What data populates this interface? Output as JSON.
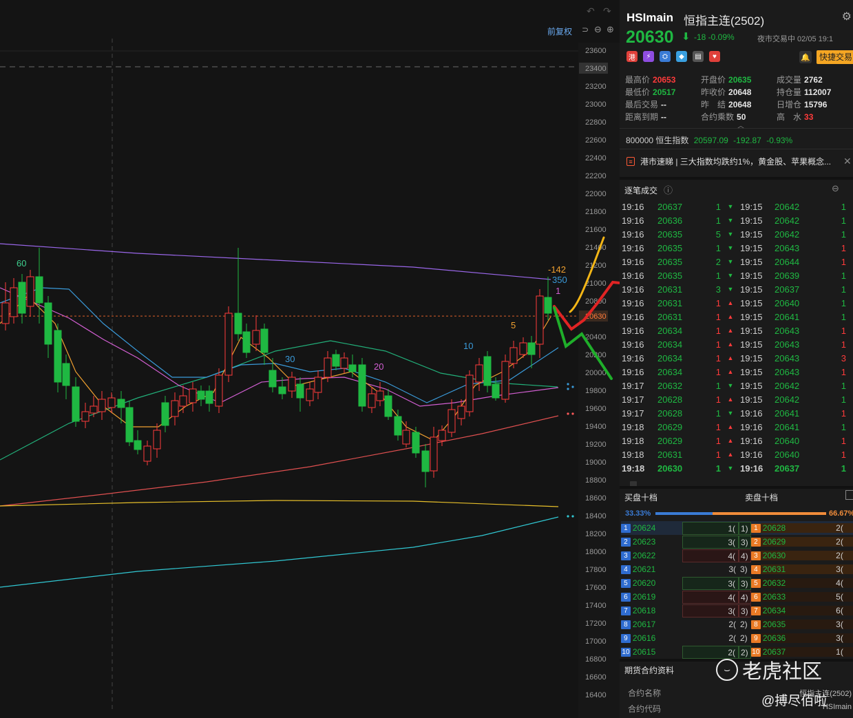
{
  "chart": {
    "fq_label": "前复权",
    "price_ticks": [
      "23600",
      "23400",
      "23200",
      "23000",
      "22800",
      "22600",
      "22400",
      "22200",
      "22000",
      "21800",
      "21600",
      "21400",
      "21200",
      "21000",
      "20800",
      "20630",
      "20400",
      "20200",
      "20000",
      "19800",
      "19600",
      "19400",
      "19200",
      "19000",
      "18800",
      "18600",
      "18400",
      "18200",
      "18000",
      "17800",
      "17600",
      "17400",
      "17200",
      "17000",
      "16800",
      "16600",
      "16400"
    ],
    "ma_labels": {
      "m60": "60",
      "m30": "30",
      "m20": "20",
      "m10": "10",
      "m5": "5",
      "m1": "1",
      "m350": "350",
      "m142": "-142"
    },
    "colors": {
      "up": "#ff3b3b",
      "down": "#1fb842",
      "ma5": "#f0a030",
      "ma10": "#3a9ad9",
      "ma20": "#d25fd2",
      "ma60": "#22b07a",
      "ma120": "#9a67ea",
      "ma250": "#e05050",
      "maY": "#e8c02a",
      "maC": "#31c9d4"
    }
  },
  "header": {
    "symbol": "HSImain",
    "name": "恒指主连(2502)",
    "price": "20630",
    "arrow": "⬇",
    "change": "-18 -0.09%",
    "status": "夜市交易中 02/05 19:1"
  },
  "badges": [
    "港",
    "⚡",
    "⛭",
    "◆",
    "▤",
    "♥"
  ],
  "quick_trade": "快捷交易",
  "stats": [
    [
      {
        "l": "最高价",
        "v": "20653",
        "c": "red"
      },
      {
        "l": "开盘价",
        "v": "20635",
        "c": "green"
      },
      {
        "l": "成交量",
        "v": "2762",
        "c": ""
      }
    ],
    [
      {
        "l": "最低价",
        "v": "20517",
        "c": "green"
      },
      {
        "l": "昨收价",
        "v": "20648",
        "c": ""
      },
      {
        "l": "持仓量",
        "v": "112007",
        "c": ""
      }
    ],
    [
      {
        "l": "最后交易",
        "v": "--",
        "c": ""
      },
      {
        "l": "昨　结",
        "v": "20648",
        "c": ""
      },
      {
        "l": "日增仓",
        "v": "15796",
        "c": ""
      }
    ],
    [
      {
        "l": "距离到期",
        "v": "--",
        "c": ""
      },
      {
        "l": "合约乘数",
        "v": "50",
        "c": ""
      },
      {
        "l": "高　水",
        "v": "33",
        "c": "red"
      }
    ]
  ],
  "index": {
    "code": "800000",
    "name": "恒生指数",
    "value": "20597.09",
    "change": "-192.87",
    "pct": "-0.93%"
  },
  "news": "港市速睇 | 三大指数均跌约1%，黄金股、苹果概念...",
  "trades_title": "逐笔成交",
  "trades": [
    [
      "19:16",
      "20637",
      "1",
      "d",
      "19:15",
      "20642",
      "1",
      "g"
    ],
    [
      "19:16",
      "20636",
      "1",
      "d",
      "19:15",
      "20642",
      "1",
      "g"
    ],
    [
      "19:16",
      "20635",
      "5",
      "d",
      "19:15",
      "20642",
      "1",
      "g"
    ],
    [
      "19:16",
      "20635",
      "1",
      "d",
      "19:15",
      "20643",
      "1",
      "r"
    ],
    [
      "19:16",
      "20635",
      "2",
      "d",
      "19:15",
      "20644",
      "1",
      "r"
    ],
    [
      "19:16",
      "20635",
      "1",
      "d",
      "19:15",
      "20639",
      "1",
      "g"
    ],
    [
      "19:16",
      "20631",
      "3",
      "d",
      "19:15",
      "20637",
      "1",
      "g"
    ],
    [
      "19:16",
      "20631",
      "1",
      "u",
      "19:15",
      "20640",
      "1",
      "g"
    ],
    [
      "19:16",
      "20631",
      "1",
      "u",
      "19:15",
      "20641",
      "1",
      "g"
    ],
    [
      "19:16",
      "20634",
      "1",
      "u",
      "19:15",
      "20643",
      "1",
      "r"
    ],
    [
      "19:16",
      "20634",
      "1",
      "u",
      "19:15",
      "20643",
      "1",
      "r"
    ],
    [
      "19:16",
      "20634",
      "1",
      "u",
      "19:15",
      "20643",
      "3",
      "r"
    ],
    [
      "19:16",
      "20634",
      "1",
      "u",
      "19:15",
      "20643",
      "1",
      "r"
    ],
    [
      "19:17",
      "20632",
      "1",
      "d",
      "19:15",
      "20642",
      "1",
      "g"
    ],
    [
      "19:17",
      "20628",
      "1",
      "u",
      "19:15",
      "20642",
      "1",
      "g"
    ],
    [
      "19:17",
      "20628",
      "1",
      "d",
      "19:16",
      "20641",
      "1",
      "r"
    ],
    [
      "19:18",
      "20629",
      "1",
      "u",
      "19:16",
      "20641",
      "1",
      "g"
    ],
    [
      "19:18",
      "20629",
      "1",
      "u",
      "19:16",
      "20640",
      "1",
      "r"
    ],
    [
      "19:18",
      "20631",
      "1",
      "u",
      "19:16",
      "20640",
      "1",
      "r"
    ],
    [
      "19:18",
      "20630",
      "1",
      "d",
      "19:16",
      "20637",
      "1",
      "g"
    ]
  ],
  "book_titles": {
    "bid": "买盘十档",
    "ask": "卖盘十档"
  },
  "ratio": {
    "bid": "33.33%",
    "ask": "66.67%"
  },
  "book": [
    [
      "1",
      "20624",
      "1(",
      "1)",
      "20628",
      "2("
    ],
    [
      "2",
      "20623",
      "3(",
      "3)",
      "20629",
      "2("
    ],
    [
      "3",
      "20622",
      "4(",
      "4)",
      "20630",
      "2("
    ],
    [
      "4",
      "20621",
      "3(",
      "3)",
      "20631",
      "3("
    ],
    [
      "5",
      "20620",
      "3(",
      "3)",
      "20632",
      "4("
    ],
    [
      "6",
      "20619",
      "4(",
      "4)",
      "20633",
      "5("
    ],
    [
      "7",
      "20618",
      "3(",
      "3)",
      "20634",
      "6("
    ],
    [
      "8",
      "20617",
      "2(",
      "2)",
      "20635",
      "3("
    ],
    [
      "9",
      "20616",
      "2(",
      "2)",
      "20636",
      "3("
    ],
    [
      "10",
      "20615",
      "2(",
      "2)",
      "20637",
      "1("
    ]
  ],
  "futures": {
    "title": "期货合约资料",
    "name_label": "合约名称",
    "name_value": "恒指主连(2502)",
    "code_label": "合约代码",
    "code_value": "HSImain"
  },
  "watermark": {
    "brand": "老虎社区",
    "user": "@搏尽佰啦"
  }
}
